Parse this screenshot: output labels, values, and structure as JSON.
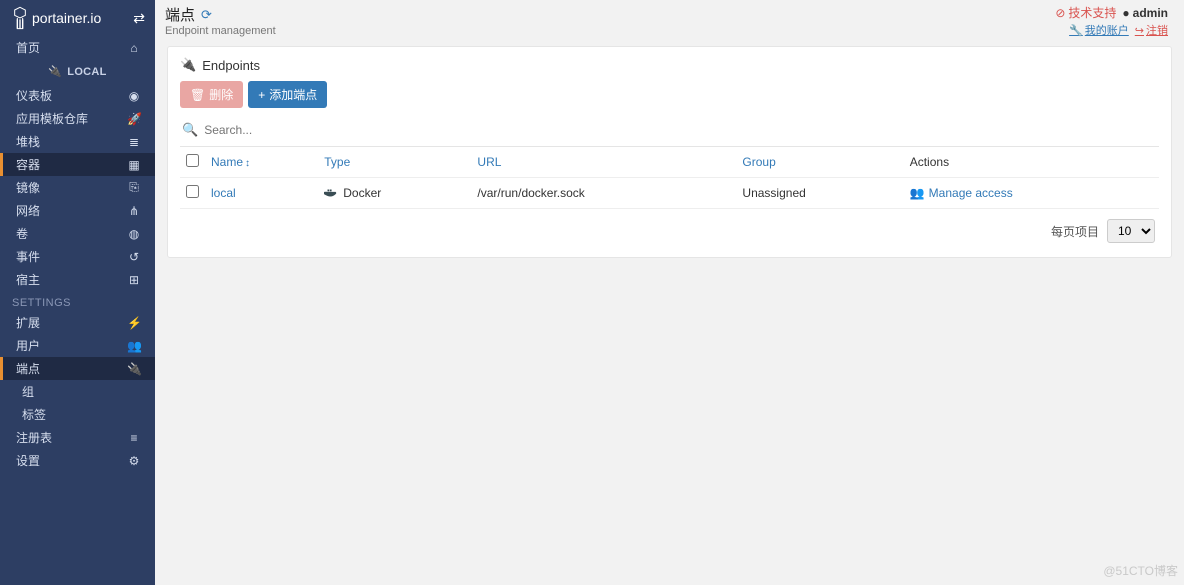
{
  "brand": "portainer.io",
  "sidebar": {
    "home": "首页",
    "local": "LOCAL",
    "items": [
      "仪表板",
      "应用模板仓库",
      "堆栈",
      "容器",
      "镜像",
      "网络",
      "卷",
      "事件",
      "宿主"
    ],
    "active_index": 3,
    "settings_head": "SETTINGS",
    "ext": "扩展",
    "users": "用户",
    "endpoints": "端点",
    "groups": "组",
    "tags": "标签",
    "registries": "注册表",
    "settings": "设置"
  },
  "header": {
    "title": "端点",
    "subtitle": "Endpoint management",
    "support": "技术支持",
    "username": "admin",
    "my_account": "我的账户",
    "logout": "注销"
  },
  "panel": {
    "title": "Endpoints",
    "delete": "删除",
    "add": "添加端点",
    "search_placeholder": "Search...",
    "cols": {
      "name": "Name",
      "type": "Type",
      "url": "URL",
      "group": "Group",
      "actions": "Actions"
    },
    "row": {
      "name": "local",
      "type": "Docker",
      "url": "/var/run/docker.sock",
      "group": "Unassigned",
      "manage": "Manage access"
    },
    "pager_label": "每页项目",
    "pager_value": "10"
  },
  "watermark": "@51CTO博客"
}
